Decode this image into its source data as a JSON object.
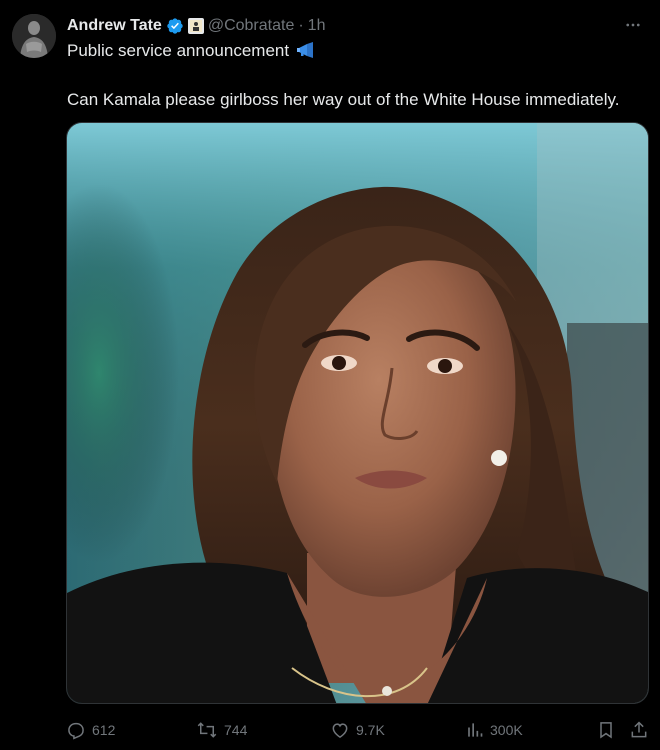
{
  "tweet": {
    "author": {
      "display_name": "Andrew Tate",
      "handle": "@Cobratate",
      "separator": "·",
      "time": "1h",
      "verified_icon": "verified-badge-icon",
      "affiliate_icon": "affiliate-badge-icon"
    },
    "text": {
      "line1": "Public service announcement",
      "line1_icon": "megaphone-icon",
      "line2": "Can Kamala please girlboss her way out of the White House immediately."
    },
    "media": {
      "type": "photo"
    },
    "actions": {
      "replies": "612",
      "reposts": "744",
      "likes": "9.7K",
      "views": "300K",
      "reply_icon": "reply-icon",
      "repost_icon": "repost-icon",
      "like_icon": "like-icon",
      "views_icon": "views-icon",
      "bookmark_icon": "bookmark-icon",
      "share_icon": "share-icon"
    },
    "more_icon": "more-options-icon"
  },
  "colors": {
    "background": "#000000",
    "text": "#e7e9ea",
    "muted": "#71767b",
    "verified": "#1d9bf0",
    "border": "#2f3336"
  }
}
